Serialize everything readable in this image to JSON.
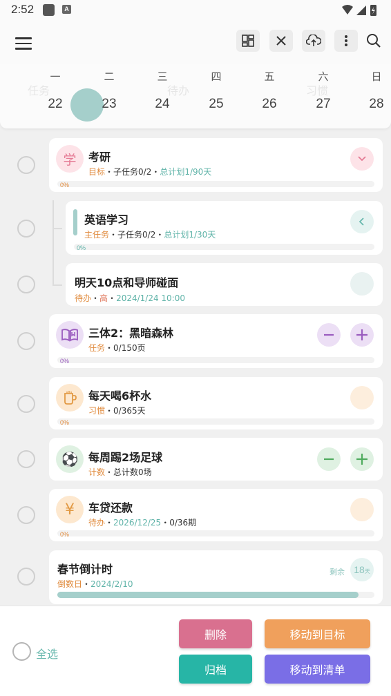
{
  "status_bar": {
    "time": "2:52",
    "notif_badge": "A"
  },
  "toolbar": {
    "menu_icon": "hamburger-icon",
    "buttons": [
      "grid-icon",
      "close-icon",
      "cloud-upload-icon",
      "more-vertical-icon",
      "search-icon"
    ]
  },
  "week": {
    "ghost_tabs": [
      "任务",
      "待办",
      "习惯"
    ],
    "days": [
      {
        "dow": "一",
        "num": "22"
      },
      {
        "dow": "二",
        "num": "23"
      },
      {
        "dow": "三",
        "num": "24"
      },
      {
        "dow": "四",
        "num": "25"
      },
      {
        "dow": "五",
        "num": "26"
      },
      {
        "dow": "六",
        "num": "27"
      },
      {
        "dow": "日",
        "num": "28"
      }
    ],
    "selected": "23"
  },
  "items": [
    {
      "icon_text": "学",
      "title": "考研",
      "meta_type": "目标",
      "meta_rest": "・子任务0/2・",
      "meta_plan": "总计划1/90天",
      "pct": "0%"
    },
    {
      "title": "英语学习",
      "meta_type": "主任务",
      "meta_rest": "・子任务0/2・",
      "meta_plan": "总计划1/30天",
      "pct": "0%"
    },
    {
      "title": "明天10点和导师碰面",
      "meta_type": "待办",
      "meta_sep": "・",
      "meta_priority": "高",
      "meta_sep2": "・",
      "meta_date": "2024/1/24 10:00"
    },
    {
      "icon": "book-icon",
      "title": "三体2：黑暗森林",
      "meta_type": "任务",
      "meta_rest": "・0/150页",
      "pct": "0%"
    },
    {
      "icon": "cup-icon",
      "title": "每天喝6杯水",
      "meta_type": "习惯",
      "meta_rest": "・0/365天",
      "pct": "0%"
    },
    {
      "icon_text": "⚽",
      "title": "每周踢2场足球",
      "meta_type": "计数",
      "meta_rest": "・总计数0场"
    },
    {
      "icon_text": "¥",
      "title": "车贷还款",
      "meta_type": "待办",
      "meta_sep": "・",
      "meta_date": "2026/12/25",
      "meta_rest": "・0/36期",
      "pct": "0%"
    },
    {
      "title": "春节倒计时",
      "meta_type": "倒数日",
      "meta_sep": "・",
      "meta_date": "2024/2/10",
      "remain_label": "剩余",
      "remain_days": "18",
      "remain_unit": "天",
      "progress": 0.95
    }
  ],
  "bottom": {
    "select_all": "全选",
    "delete": "删除",
    "move_to_goal": "移动到目标",
    "archive": "归档",
    "move_to_list": "移动到清单"
  },
  "colors": {
    "teal": "#5fb3a8",
    "pink_btn": "#d9708f",
    "orange_btn": "#f0a05c",
    "teal_btn": "#27b5a6",
    "purple_btn": "#7a6ee6"
  }
}
